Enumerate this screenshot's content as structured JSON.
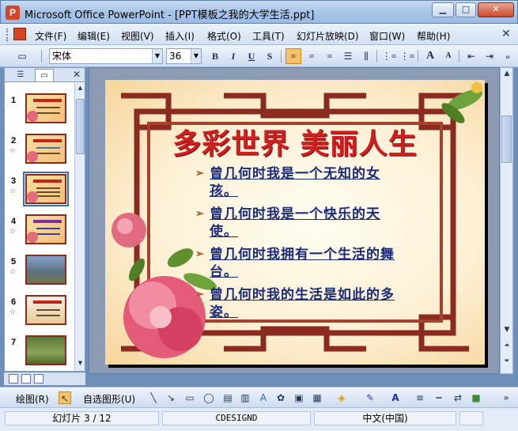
{
  "window": {
    "title": "Microsoft Office PowerPoint - [PPT模板之我的大学生活.ppt]",
    "min_label": "▁",
    "max_label": "□",
    "close_label": "✕"
  },
  "menu": {
    "items": [
      "文件(F)",
      "编辑(E)",
      "视图(V)",
      "插入(I)",
      "格式(O)",
      "工具(T)",
      "幻灯片放映(D)",
      "窗口(W)",
      "帮助(H)"
    ],
    "close_label": "✕"
  },
  "toolbar": {
    "font_name": "宋体",
    "font_size": "36",
    "bold": "B",
    "italic": "I",
    "underline": "U",
    "shadow": "S",
    "grow_font": "A",
    "shrink_font": "A"
  },
  "slides_panel": {
    "tab_outline_icon": "outline-icon",
    "tab_slides_icon": "slides-icon",
    "close_label": "✕",
    "thumbnails": [
      {
        "number": "1",
        "star": ""
      },
      {
        "number": "2",
        "star": "☆"
      },
      {
        "number": "3",
        "star": "☆"
      },
      {
        "number": "4",
        "star": "☆"
      },
      {
        "number": "5",
        "star": "☆"
      },
      {
        "number": "6",
        "star": "☆"
      },
      {
        "number": "7",
        "star": ""
      }
    ],
    "selected": 3
  },
  "slide": {
    "title": "多彩世界 美丽人生",
    "bullets": [
      "曾几何时我是一个无知的女孩。",
      "曾几何时我是一个快乐的天使。",
      "曾几何时我拥有一个生活的舞台。",
      "曾几何时我的生活是如此的多姿。"
    ],
    "colors": {
      "title": "#d11e1e",
      "bullet_text": "#1a2a7a",
      "frame": "#8b2a1f"
    }
  },
  "drawing_toolbar": {
    "draw_label": "绘图(R)",
    "autoshapes_label": "自选图形(U)"
  },
  "status": {
    "slide_info": "幻灯片 3 / 12",
    "design": "CDESIGND",
    "language": "中文(中国)"
  }
}
